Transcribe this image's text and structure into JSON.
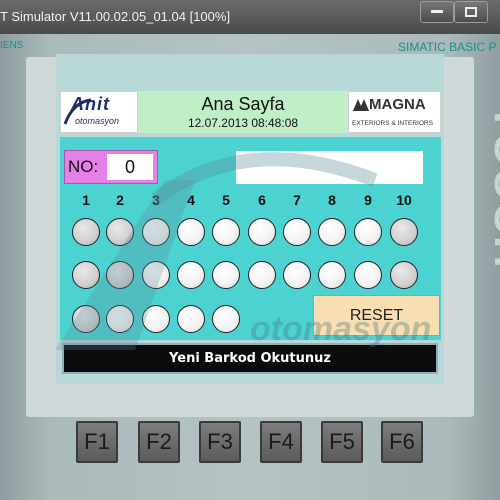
{
  "window": {
    "title": "T Simulator V11.00.02.05_01.04 [100%]",
    "controls": [
      "minimize-icon",
      "maximize-icon"
    ]
  },
  "device": {
    "brand_left": "IENS",
    "brand_right": "SIMATIC BASIC P",
    "side_text": "TOUCH"
  },
  "header": {
    "logo_left": "Anit",
    "logo_left_sub": "otomasyon",
    "title": "Ana Sayfa",
    "datetime": "12.07.2013 08:48:08",
    "logo_right": "MAGNA",
    "logo_right_sub": "EXTERIORS & INTERIORS"
  },
  "counter": {
    "label": "NO:",
    "value": "0"
  },
  "barcode_input": {
    "value": ""
  },
  "columns": [
    "1",
    "2",
    "3",
    "4",
    "5",
    "6",
    "7",
    "8",
    "9",
    "10"
  ],
  "slots": {
    "row1_count": 10,
    "row2_count": 10,
    "row3_count": 5
  },
  "reset_button": {
    "label": "RESET"
  },
  "message": {
    "text": "Yeni Barkod Okutunuz"
  },
  "function_keys": [
    "F1",
    "F2",
    "F3",
    "F4",
    "F5",
    "F6"
  ],
  "watermark": {
    "text": "otomasyon"
  },
  "colors": {
    "content_bg": "#4dd2d2",
    "header_bg": "#bfeec7",
    "counter_bg": "#e580e8",
    "reset_bg": "#f8deb0",
    "message_bg": "#0b0b0b"
  }
}
